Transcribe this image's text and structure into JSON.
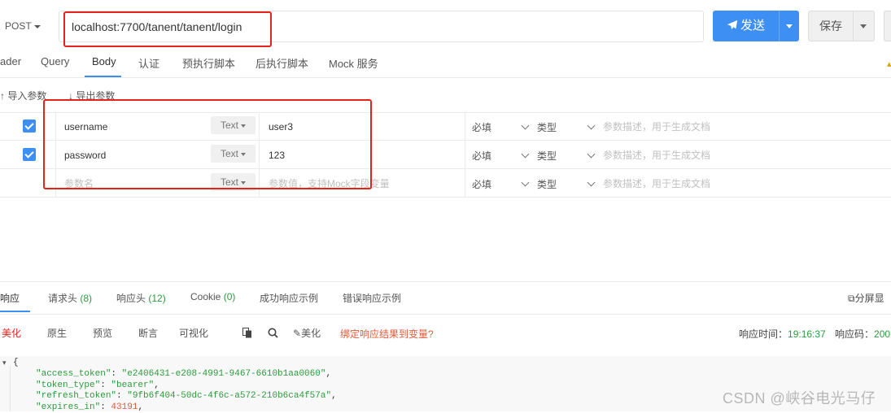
{
  "request": {
    "method": "POST",
    "url": "localhost:7700/tanent/tanent/login",
    "send_label": "发送",
    "save_label": "保存",
    "tabs": [
      "ader",
      "Query",
      "Body",
      "认证",
      "预执行脚本",
      "后执行脚本",
      "Mock 服务"
    ],
    "active_tab": "Body",
    "import_label": "导入参数",
    "export_label": "导出参数"
  },
  "params": {
    "rows": [
      {
        "name": "username",
        "type": "Text",
        "value": "user3",
        "required": "必填",
        "kind": "类型",
        "desc": "参数描述，用于生成文档",
        "checked": true
      },
      {
        "name": "password",
        "type": "Text",
        "value": "123",
        "required": "必填",
        "kind": "类型",
        "desc": "参数描述，用于生成文档",
        "checked": true
      }
    ],
    "new_row": {
      "name_placeholder": "参数名",
      "type": "Text",
      "value_placeholder": "参数值，支持Mock字段变量",
      "required": "必填",
      "kind": "类型",
      "desc": "参数描述，用于生成文档"
    }
  },
  "response": {
    "tabs": [
      {
        "label": "响应",
        "count": ""
      },
      {
        "label": "请求头",
        "count": "(8)"
      },
      {
        "label": "响应头",
        "count": "(12)"
      },
      {
        "label": "Cookie",
        "count": "(0)"
      },
      {
        "label": "成功响应示例",
        "count": ""
      },
      {
        "label": "错误响应示例",
        "count": ""
      }
    ],
    "split_label": "分屏显",
    "formats": [
      "美化",
      "原生",
      "预览",
      "断言",
      "可视化"
    ],
    "beautify_label": "美化",
    "bind_label": "绑定响应结果到变量?",
    "time_label": "响应时间：",
    "time_value": "19:16:37",
    "code_label": "响应码：",
    "code_value": "200",
    "json": {
      "open": "{",
      "access_token_key": "\"access_token\"",
      "access_token_val": "\"e2406431-e208-4991-9467-6610b1aa0060\"",
      "token_type_key": "\"token_type\"",
      "token_type_val": "\"bearer\"",
      "refresh_token_key": "\"refresh_token\"",
      "refresh_token_val": "\"9fb6f404-50dc-4f6c-a572-210b6ca4f57a\"",
      "expires_in_key": "\"expires_in\"",
      "expires_in_val": "43191"
    }
  },
  "watermark": "CSDN @峡谷电光马仔",
  "colors": {
    "accent": "#3d8ff3",
    "highlight_box": "#e4241c",
    "json_string": "#2c9a3d"
  }
}
